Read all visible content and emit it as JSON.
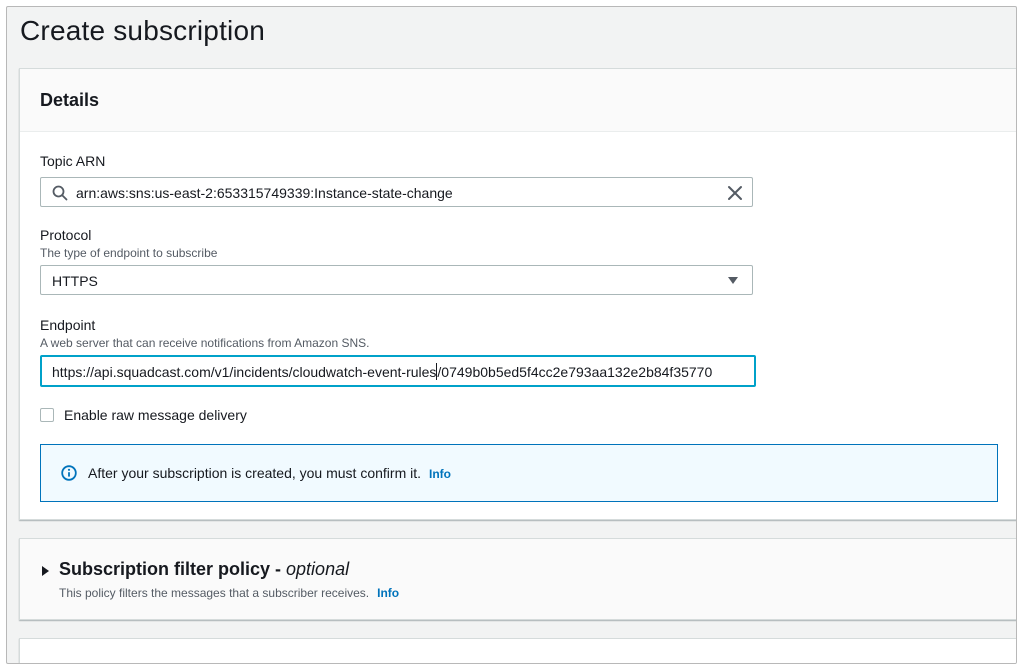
{
  "page": {
    "title": "Create subscription"
  },
  "details": {
    "heading": "Details",
    "topic_arn": {
      "label": "Topic ARN",
      "value": "arn:aws:sns:us-east-2:653315749339:Instance-state-change"
    },
    "protocol": {
      "label": "Protocol",
      "description": "The type of endpoint to subscribe",
      "value": "HTTPS"
    },
    "endpoint": {
      "label": "Endpoint",
      "description": "A web server that can receive notifications from Amazon SNS.",
      "value_before_cursor": "https://api.squadcast.com/v1/incidents/cloudwatch-event-rules",
      "value_after_cursor": "/0749b0b5ed5f4cc2e793aa132e2b84f35770"
    },
    "raw_delivery": {
      "label": "Enable raw message delivery",
      "checked": false
    },
    "alert": {
      "text": "After your subscription is created, you must confirm it.",
      "link": "Info"
    }
  },
  "filter_policy": {
    "title": "Subscription filter policy - ",
    "title_optional": "optional",
    "description": "This policy filters the messages that a subscriber receives.",
    "link": "Info"
  },
  "colors": {
    "accent": "#0073bb",
    "focus": "#00a1c9",
    "alert_bg": "#f1faff"
  }
}
